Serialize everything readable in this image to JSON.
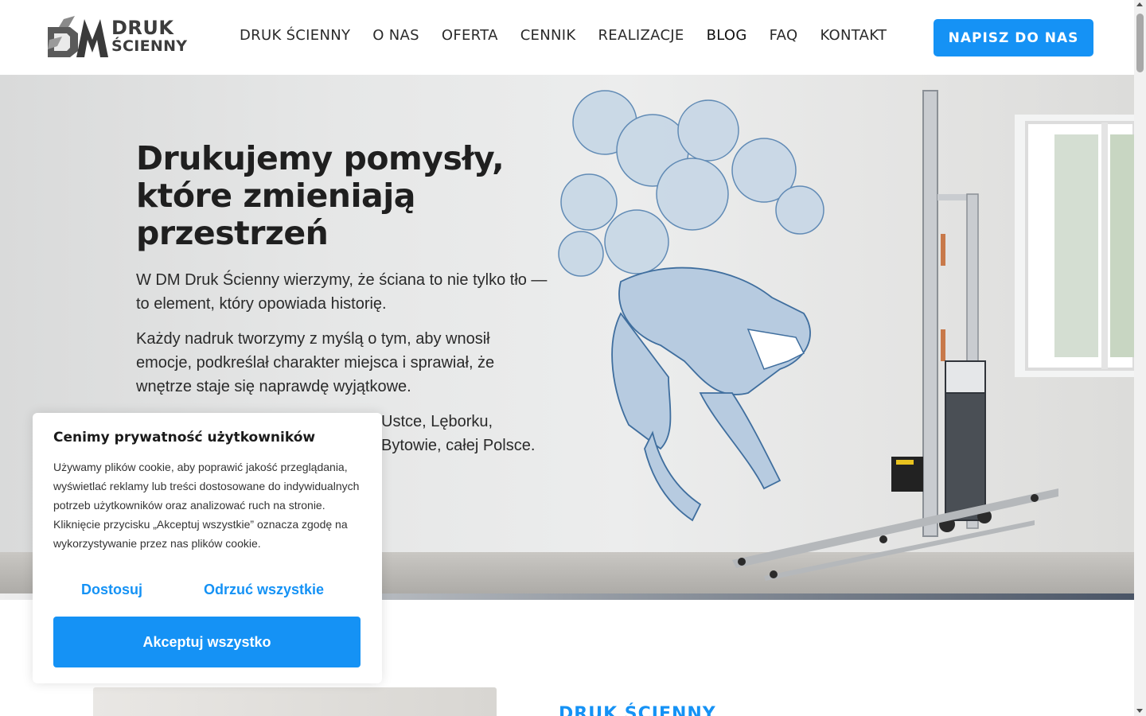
{
  "header": {
    "logo_line1": "DRUK",
    "logo_line2": "ŚCIENNY",
    "nav": [
      "DRUK ŚCIENNY",
      "O NAS",
      "OFERTA",
      "CENNIK",
      "REALIZACJE",
      "BLOG",
      "FAQ",
      "KONTAKT"
    ],
    "cta_label": "NAPISZ DO NAS"
  },
  "hero": {
    "title": "Drukujemy pomysły, które zmieniają przestrzeń",
    "paragraph1": "W DM Druk Ścienny wierzymy, że ściana to nie tylko tło — to element, który opowiada historię.",
    "paragraph2": "Każdy nadruk tworzymy z myślą o tym, aby wnosił emocje, podkreślał charakter miejsca i sprawiał, że wnętrze staje się naprawdę wyjątkowe.",
    "paragraph3": "Ustce, Lęborku, Bytowie, całej Polsce."
  },
  "section": {
    "label": "DRUK ŚCIENNY"
  },
  "cookie": {
    "title": "Cenimy prywatność użytkowników",
    "text": "Używamy plików cookie, aby poprawić jakość przeglądania, wyświetlać reklamy lub treści dostosowane do indywidualnych potrzeb użytkowników oraz analizować ruch na stronie. Kliknięcie przycisku „Akceptuj wszystkie” oznacza zgodę na wykorzystywanie przez nas plików cookie.",
    "customize_label": "Dostosuj",
    "reject_label": "Odrzuć wszystkie",
    "accept_label": "Akceptuj wszystko"
  },
  "colors": {
    "accent": "#1592f5",
    "text": "#1f1f1f"
  },
  "icons": [
    "logo-mark-icon",
    "scroll-up-icon",
    "scroll-down-icon"
  ]
}
